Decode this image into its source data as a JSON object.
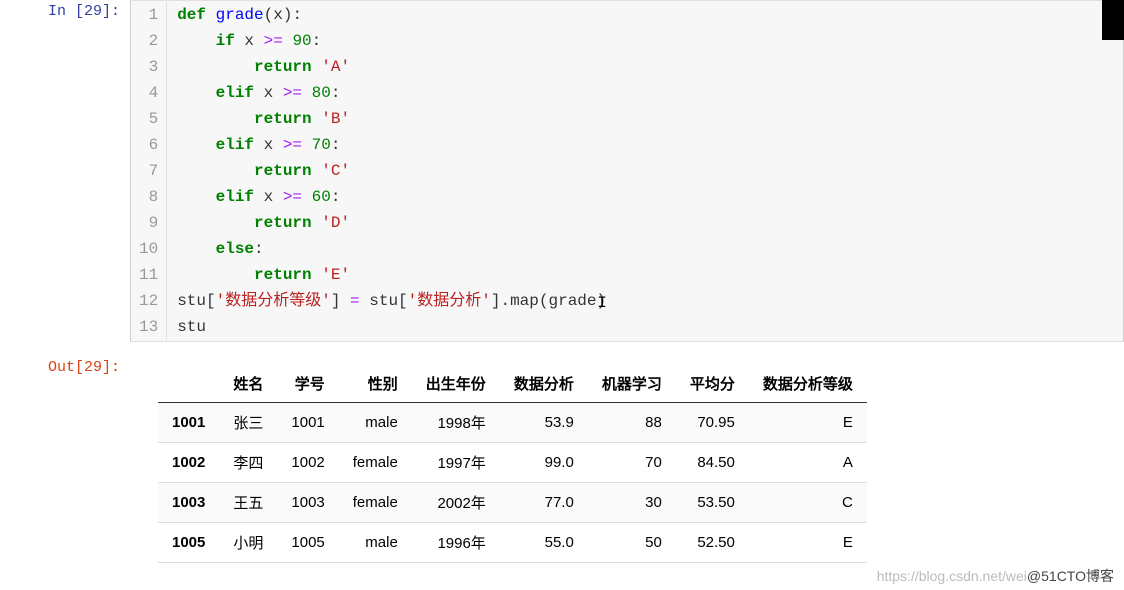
{
  "prompts": {
    "in": "In  [29]:",
    "out": "Out[29]:"
  },
  "code": {
    "lines": [
      {
        "n": "1",
        "seg": [
          {
            "c": "k-def",
            "t": "def"
          },
          {
            "c": "txt",
            "t": " "
          },
          {
            "c": "fn",
            "t": "grade"
          },
          {
            "c": "txt",
            "t": "(x):"
          }
        ]
      },
      {
        "n": "2",
        "seg": [
          {
            "c": "txt",
            "t": "    "
          },
          {
            "c": "k-if",
            "t": "if"
          },
          {
            "c": "txt",
            "t": " x "
          },
          {
            "c": "op",
            "t": ">="
          },
          {
            "c": "txt",
            "t": " "
          },
          {
            "c": "num",
            "t": "90"
          },
          {
            "c": "txt",
            "t": ":"
          }
        ]
      },
      {
        "n": "3",
        "seg": [
          {
            "c": "txt",
            "t": "        "
          },
          {
            "c": "k-ret",
            "t": "return"
          },
          {
            "c": "txt",
            "t": " "
          },
          {
            "c": "str",
            "t": "'A'"
          }
        ]
      },
      {
        "n": "4",
        "seg": [
          {
            "c": "txt",
            "t": "    "
          },
          {
            "c": "k-if",
            "t": "elif"
          },
          {
            "c": "txt",
            "t": " x "
          },
          {
            "c": "op",
            "t": ">="
          },
          {
            "c": "txt",
            "t": " "
          },
          {
            "c": "num",
            "t": "80"
          },
          {
            "c": "txt",
            "t": ":"
          }
        ]
      },
      {
        "n": "5",
        "seg": [
          {
            "c": "txt",
            "t": "        "
          },
          {
            "c": "k-ret",
            "t": "return"
          },
          {
            "c": "txt",
            "t": " "
          },
          {
            "c": "str",
            "t": "'B'"
          }
        ]
      },
      {
        "n": "6",
        "seg": [
          {
            "c": "txt",
            "t": "    "
          },
          {
            "c": "k-if",
            "t": "elif"
          },
          {
            "c": "txt",
            "t": " x "
          },
          {
            "c": "op",
            "t": ">="
          },
          {
            "c": "txt",
            "t": " "
          },
          {
            "c": "num",
            "t": "70"
          },
          {
            "c": "txt",
            "t": ":"
          }
        ]
      },
      {
        "n": "7",
        "seg": [
          {
            "c": "txt",
            "t": "        "
          },
          {
            "c": "k-ret",
            "t": "return"
          },
          {
            "c": "txt",
            "t": " "
          },
          {
            "c": "str",
            "t": "'C'"
          }
        ]
      },
      {
        "n": "8",
        "seg": [
          {
            "c": "txt",
            "t": "    "
          },
          {
            "c": "k-if",
            "t": "elif"
          },
          {
            "c": "txt",
            "t": " x "
          },
          {
            "c": "op",
            "t": ">="
          },
          {
            "c": "txt",
            "t": " "
          },
          {
            "c": "num",
            "t": "60"
          },
          {
            "c": "txt",
            "t": ":"
          }
        ]
      },
      {
        "n": "9",
        "seg": [
          {
            "c": "txt",
            "t": "        "
          },
          {
            "c": "k-ret",
            "t": "return"
          },
          {
            "c": "txt",
            "t": " "
          },
          {
            "c": "str",
            "t": "'D'"
          }
        ]
      },
      {
        "n": "10",
        "seg": [
          {
            "c": "txt",
            "t": "    "
          },
          {
            "c": "k-if",
            "t": "else"
          },
          {
            "c": "txt",
            "t": ":"
          }
        ]
      },
      {
        "n": "11",
        "seg": [
          {
            "c": "txt",
            "t": "        "
          },
          {
            "c": "k-ret",
            "t": "return"
          },
          {
            "c": "txt",
            "t": " "
          },
          {
            "c": "str",
            "t": "'E'"
          }
        ]
      },
      {
        "n": "12",
        "seg": [
          {
            "c": "txt",
            "t": "stu["
          },
          {
            "c": "str",
            "t": "'数据分析等级'"
          },
          {
            "c": "txt",
            "t": "] "
          },
          {
            "c": "op",
            "t": "="
          },
          {
            "c": "txt",
            "t": " stu["
          },
          {
            "c": "str",
            "t": "'数据分析'"
          },
          {
            "c": "txt",
            "t": "]."
          },
          {
            "c": "txt",
            "t": "map(grade)"
          }
        ]
      },
      {
        "n": "13",
        "seg": [
          {
            "c": "txt",
            "t": "stu"
          }
        ]
      }
    ]
  },
  "table": {
    "headers": [
      "",
      "姓名",
      "学号",
      "性别",
      "出生年份",
      "数据分析",
      "机器学习",
      "平均分",
      "数据分析等级"
    ],
    "rows": [
      {
        "idx": "1001",
        "cells": [
          "张三",
          "1001",
          "male",
          "1998年",
          "53.9",
          "88",
          "70.95",
          "E"
        ]
      },
      {
        "idx": "1002",
        "cells": [
          "李四",
          "1002",
          "female",
          "1997年",
          "99.0",
          "70",
          "84.50",
          "A"
        ]
      },
      {
        "idx": "1003",
        "cells": [
          "王五",
          "1003",
          "female",
          "2002年",
          "77.0",
          "30",
          "53.50",
          "C"
        ]
      },
      {
        "idx": "1005",
        "cells": [
          "小明",
          "1005",
          "male",
          "1996年",
          "55.0",
          "50",
          "52.50",
          "E"
        ]
      }
    ]
  },
  "watermark": {
    "light": "https://blog.csdn.net/wei",
    "dark": "@51CTO博客"
  }
}
